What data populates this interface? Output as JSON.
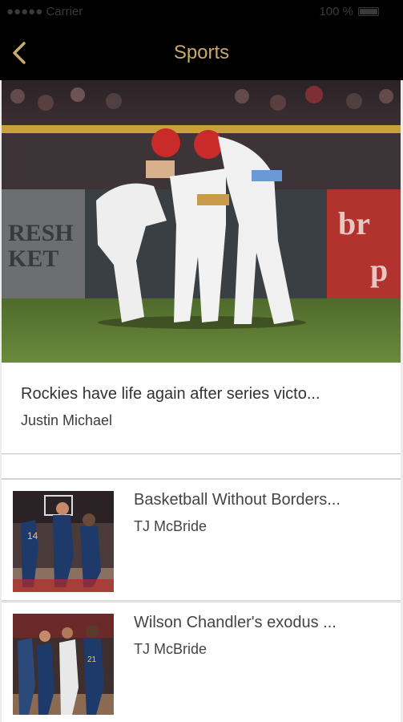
{
  "status_bar": {
    "carrier": "●●●●● Carrier",
    "time": "",
    "battery": "100 %"
  },
  "nav": {
    "title": "Sports",
    "back_icon": "chevron-left-icon",
    "accent_color": "#c8a96a"
  },
  "featured": {
    "title": "Rockies have life again after series victo...",
    "author": "Justin Michael"
  },
  "articles": [
    {
      "title": "Basketball Without Borders...",
      "author": "TJ McBride"
    },
    {
      "title": "Wilson Chandler's exodus ...",
      "author": "TJ McBride"
    }
  ]
}
